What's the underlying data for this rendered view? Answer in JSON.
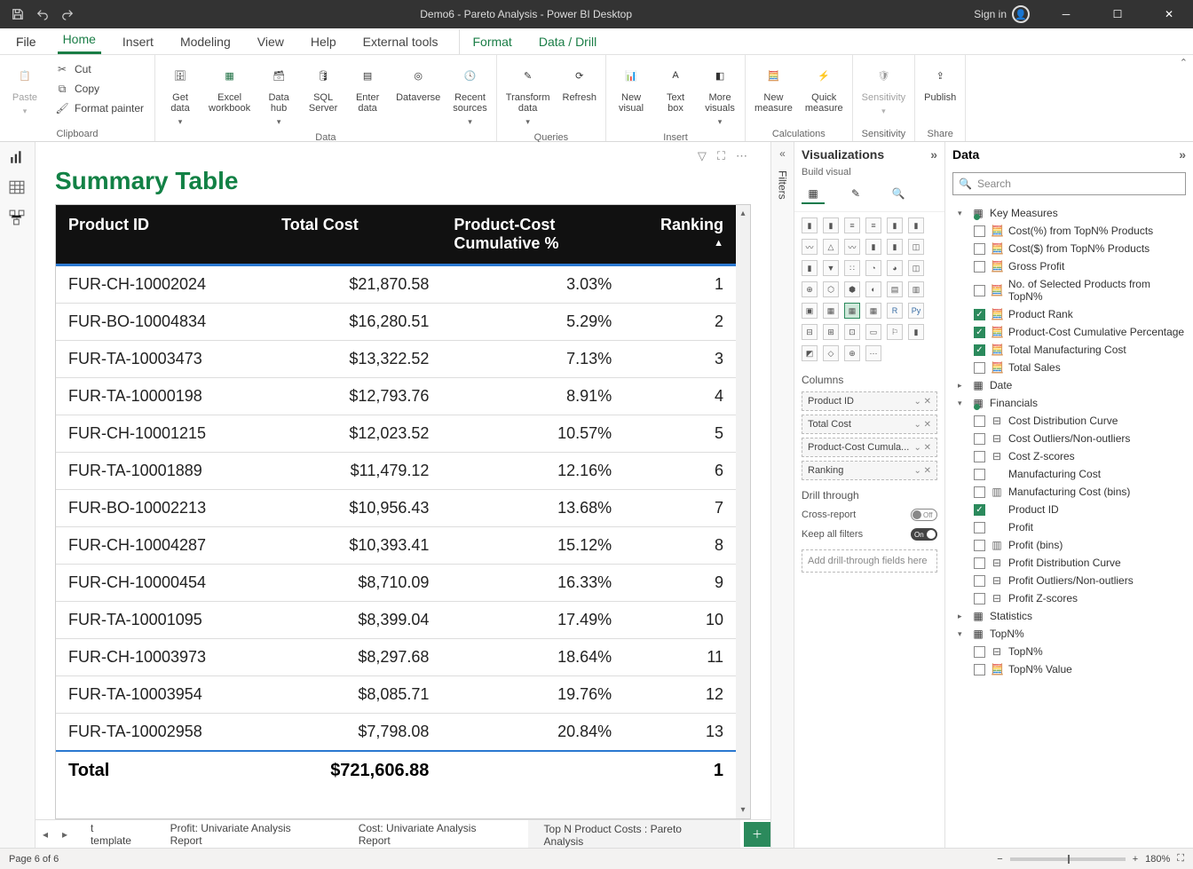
{
  "titlebar": {
    "title": "Demo6 - Pareto Analysis - Power BI Desktop",
    "signin": "Sign in"
  },
  "menu": {
    "file": "File",
    "home": "Home",
    "insert": "Insert",
    "modeling": "Modeling",
    "view": "View",
    "help": "Help",
    "external": "External tools",
    "format": "Format",
    "datadrill": "Data / Drill"
  },
  "ribbon": {
    "clipboard": {
      "label": "Clipboard",
      "paste": "Paste",
      "cut": "Cut",
      "copy": "Copy",
      "fp": "Format painter"
    },
    "data": {
      "label": "Data",
      "get": "Get\ndata",
      "excel": "Excel\nworkbook",
      "hub": "Data\nhub",
      "sql": "SQL\nServer",
      "enter": "Enter\ndata",
      "dataverse": "Dataverse",
      "recent": "Recent\nsources"
    },
    "queries": {
      "label": "Queries",
      "transform": "Transform\ndata",
      "refresh": "Refresh"
    },
    "insert": {
      "label": "Insert",
      "newvisual": "New\nvisual",
      "textbox": "Text\nbox",
      "more": "More\nvisuals"
    },
    "calc": {
      "label": "Calculations",
      "newmeasure": "New\nmeasure",
      "quick": "Quick\nmeasure"
    },
    "sens": {
      "label": "Sensitivity",
      "btn": "Sensitivity"
    },
    "share": {
      "label": "Share",
      "publish": "Publish"
    }
  },
  "filtersPane": {
    "label": "Filters"
  },
  "report": {
    "title": "Summary Table",
    "columns": {
      "pid": "Product ID",
      "cost": "Total Cost",
      "pct": "Product-Cost Cumulative %",
      "rank": "Ranking"
    },
    "rows": [
      {
        "pid": "FUR-CH-10002024",
        "cost": "$21,870.58",
        "pct": "3.03%",
        "rank": "1"
      },
      {
        "pid": "FUR-BO-10004834",
        "cost": "$16,280.51",
        "pct": "5.29%",
        "rank": "2"
      },
      {
        "pid": "FUR-TA-10003473",
        "cost": "$13,322.52",
        "pct": "7.13%",
        "rank": "3"
      },
      {
        "pid": "FUR-TA-10000198",
        "cost": "$12,793.76",
        "pct": "8.91%",
        "rank": "4"
      },
      {
        "pid": "FUR-CH-10001215",
        "cost": "$12,023.52",
        "pct": "10.57%",
        "rank": "5"
      },
      {
        "pid": "FUR-TA-10001889",
        "cost": "$11,479.12",
        "pct": "12.16%",
        "rank": "6"
      },
      {
        "pid": "FUR-BO-10002213",
        "cost": "$10,956.43",
        "pct": "13.68%",
        "rank": "7"
      },
      {
        "pid": "FUR-CH-10004287",
        "cost": "$10,393.41",
        "pct": "15.12%",
        "rank": "8"
      },
      {
        "pid": "FUR-CH-10000454",
        "cost": "$8,710.09",
        "pct": "16.33%",
        "rank": "9"
      },
      {
        "pid": "FUR-TA-10001095",
        "cost": "$8,399.04",
        "pct": "17.49%",
        "rank": "10"
      },
      {
        "pid": "FUR-CH-10003973",
        "cost": "$8,297.68",
        "pct": "18.64%",
        "rank": "11"
      },
      {
        "pid": "FUR-TA-10003954",
        "cost": "$8,085.71",
        "pct": "19.76%",
        "rank": "12"
      },
      {
        "pid": "FUR-TA-10002958",
        "cost": "$7,798.08",
        "pct": "20.84%",
        "rank": "13"
      }
    ],
    "total": {
      "label": "Total",
      "cost": "$721,606.88",
      "rank": "1"
    }
  },
  "pages": {
    "p1": "t template",
    "p2": "Profit: Univariate Analysis Report",
    "p3": "Cost: Univariate Analysis Report",
    "p4": "Top N Product Costs : Pareto Analysis"
  },
  "vizpane": {
    "title": "Visualizations",
    "sub": "Build visual",
    "columnsLabel": "Columns",
    "wells": {
      "w1": "Product ID",
      "w2": "Total Cost",
      "w3": "Product-Cost Cumula...",
      "w4": "Ranking"
    },
    "drill": "Drill through",
    "cross": "Cross-report",
    "keep": "Keep all filters",
    "addDrill": "Add drill-through fields here"
  },
  "datapane": {
    "title": "Data",
    "searchPlaceholder": "Search",
    "groups": {
      "keyMeasures": "Key Measures",
      "date": "Date",
      "financials": "Financials",
      "statistics": "Statistics",
      "topn": "TopN%"
    },
    "fields": {
      "km1": "Cost(%) from TopN% Products",
      "km2": "Cost($) from TopN% Products",
      "km3": "Gross Profit",
      "km4": "No. of Selected Products from TopN%",
      "km5": "Product Rank",
      "km6": "Product-Cost Cumulative Percentage",
      "km7": "Total Manufacturing Cost",
      "km8": "Total Sales",
      "f1": "Cost Distribution Curve",
      "f2": "Cost Outliers/Non-outliers",
      "f3": "Cost Z-scores",
      "f4": "Manufacturing Cost",
      "f5": "Manufacturing Cost (bins)",
      "f6": "Product ID",
      "f7": "Profit",
      "f8": "Profit (bins)",
      "f9": "Profit Distribution Curve",
      "f10": "Profit Outliers/Non-outliers",
      "f11": "Profit Z-scores",
      "t1": "TopN%",
      "t2": "TopN% Value"
    }
  },
  "status": {
    "page": "Page 6 of 6",
    "zoom": "180%"
  }
}
